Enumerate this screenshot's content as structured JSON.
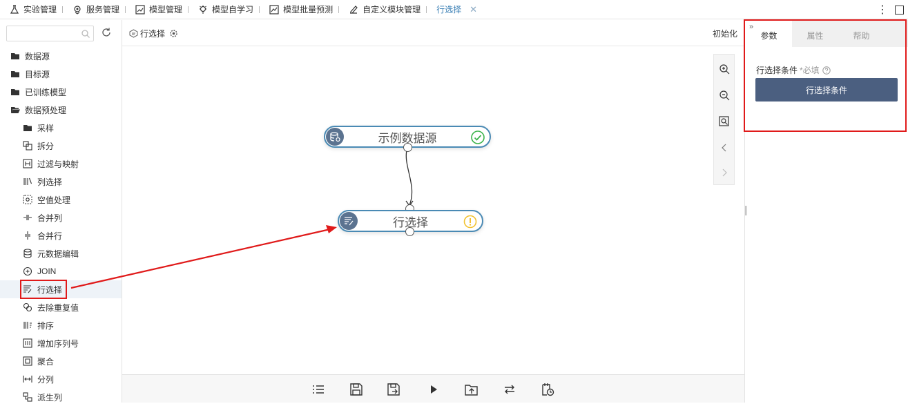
{
  "tabs": [
    {
      "label": "实验管理",
      "icon": "flask-icon"
    },
    {
      "label": "服务管理",
      "icon": "service-icon"
    },
    {
      "label": "模型管理",
      "icon": "chart-box-icon"
    },
    {
      "label": "模型自学习",
      "icon": "bulb-icon"
    },
    {
      "label": "模型批量预测",
      "icon": "line-chart-icon"
    },
    {
      "label": "自定义模块管理",
      "icon": "edit-doc-icon"
    },
    {
      "label": "行选择",
      "active": true
    }
  ],
  "sidebar": {
    "search_placeholder": "",
    "items": [
      {
        "label": "数据源",
        "icon": "folder-icon"
      },
      {
        "label": "目标源",
        "icon": "folder-icon"
      },
      {
        "label": "已训练模型",
        "icon": "folder-icon"
      },
      {
        "label": "数据预处理",
        "icon": "folder-open-icon"
      },
      {
        "label": "采样",
        "icon": "folder-icon"
      },
      {
        "label": "拆分",
        "icon": "split-icon"
      },
      {
        "label": "过滤与映射",
        "icon": "filter-map-icon"
      },
      {
        "label": "列选择",
        "icon": "column-select-icon"
      },
      {
        "label": "空值处理",
        "icon": "null-handle-icon"
      },
      {
        "label": "合并列",
        "icon": "merge-column-icon"
      },
      {
        "label": "合并行",
        "icon": "merge-row-icon"
      },
      {
        "label": "元数据编辑",
        "icon": "database-icon"
      },
      {
        "label": "JOIN",
        "icon": "join-icon"
      },
      {
        "label": "行选择",
        "icon": "row-select-icon"
      },
      {
        "label": "去除重复值",
        "icon": "dedupe-icon"
      },
      {
        "label": "排序",
        "icon": "sort-icon"
      },
      {
        "label": "增加序列号",
        "icon": "serial-number-icon"
      },
      {
        "label": "聚合",
        "icon": "aggregate-icon"
      },
      {
        "label": "分列",
        "icon": "split-column-icon"
      },
      {
        "label": "派生列",
        "icon": "derived-column-icon"
      }
    ]
  },
  "canvas": {
    "breadcrumb": "行选择",
    "init_label": "初始化",
    "nodes": [
      {
        "label": "示例数据源",
        "status": "success"
      },
      {
        "label": "行选择",
        "status": "warning"
      }
    ]
  },
  "right_panel": {
    "tabs": [
      "参数",
      "属性",
      "帮助"
    ],
    "active_tab": "参数",
    "field_label": "行选择条件",
    "required_text": "*必填",
    "button_label": "行选择条件"
  },
  "colors": {
    "accent": "#3a7fb5",
    "node_border": "#4a8ab4",
    "primary_button": "#4b5f80",
    "highlight": "#e01a1a",
    "success": "#3bb34a",
    "warning": "#f2c230"
  }
}
